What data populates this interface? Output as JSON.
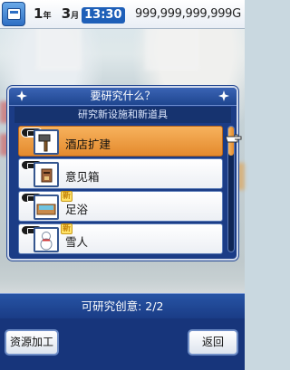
{
  "status": {
    "year_value": "1",
    "year_unit": "年",
    "month_value": "3",
    "month_unit": "月",
    "clock": "13:30",
    "money": "999,999,999,999G"
  },
  "dialog": {
    "title": "要研究什么？",
    "subtitle": "研究新设施和新道具",
    "items": [
      {
        "label": "酒店扩建",
        "icon": "hammer-icon",
        "selected": true,
        "is_new": false
      },
      {
        "label": "意见箱",
        "icon": "suggestion-box-icon",
        "selected": false,
        "is_new": false
      },
      {
        "label": "足浴",
        "icon": "footbath-icon",
        "selected": false,
        "is_new": true,
        "new_label": "新"
      },
      {
        "label": "雪人",
        "icon": "snowman-icon",
        "selected": false,
        "is_new": true,
        "new_label": "新"
      }
    ]
  },
  "footer": {
    "ideas_text": "可研究创意: 2/2",
    "resource_button": "资源加工",
    "back_button": "返回"
  },
  "colors": {
    "panel_blue": "#1b3c86",
    "selected_orange": "#e8922f"
  }
}
